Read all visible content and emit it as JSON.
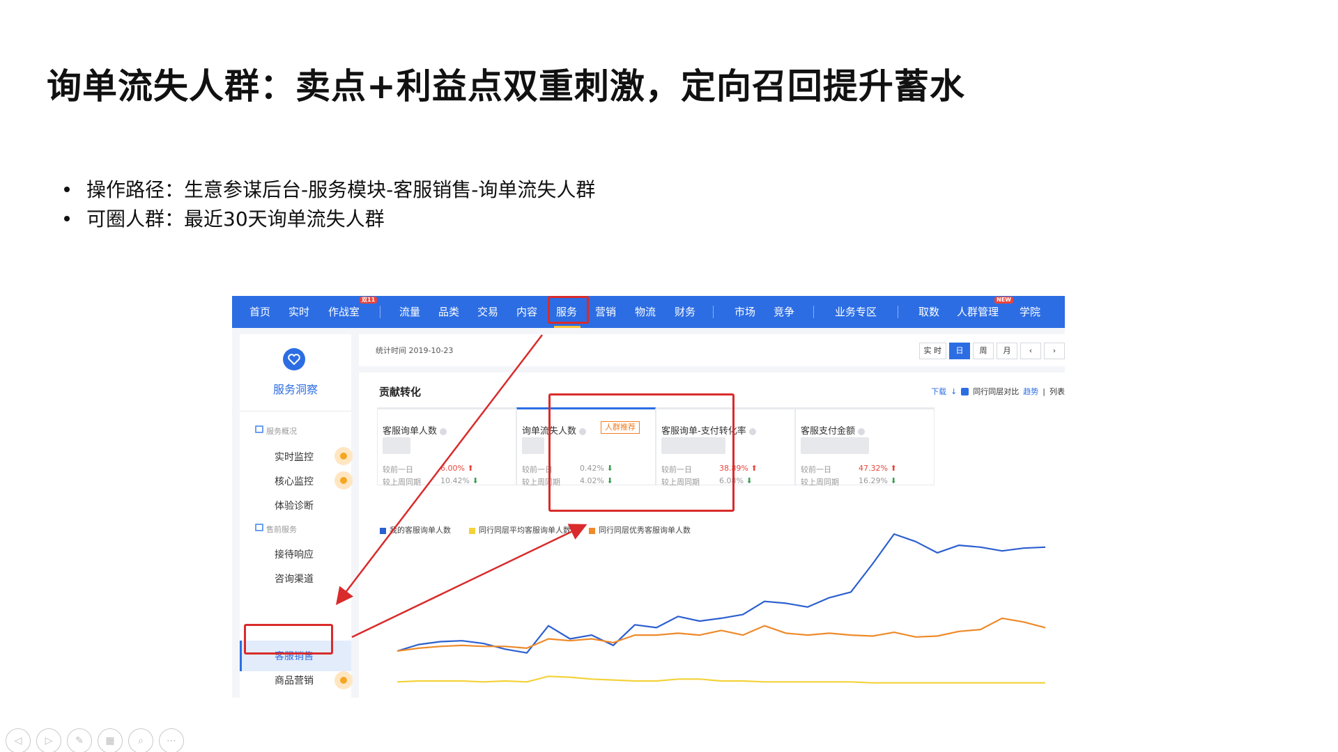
{
  "slide": {
    "title": "询单流失人群：卖点+利益点双重刺激，定向召回提升蓄水",
    "bullets": [
      "操作路径：生意参谋后台-服务模块-客服销售-询单流失人群",
      "可圈人群：最近30天询单流失人群"
    ]
  },
  "app": {
    "nav": [
      "首页",
      "实时",
      "作战室",
      "流量",
      "品类",
      "交易",
      "内容",
      "服务",
      "营销",
      "物流",
      "财务",
      "市场",
      "竞争",
      "业务专区",
      "取数",
      "人群管理",
      "学院"
    ],
    "nav_badges": {
      "zhanzhanshi": "双11",
      "renqun": "NEW"
    },
    "active_nav": "服务",
    "sidebar": {
      "title": "服务洞察",
      "sections": [
        "服务概况",
        "售前服务"
      ],
      "items": [
        "实时监控",
        "核心监控",
        "体验诊断",
        "接待响应",
        "咨询渠道",
        "客服销售",
        "商品营销"
      ],
      "active_item": "客服销售"
    },
    "stat_time": "统计时间 2019-10-23",
    "period_buttons": [
      "实 时",
      "日",
      "周",
      "月",
      "‹",
      "›"
    ],
    "active_period": "日",
    "panel": {
      "title": "贡献转化",
      "tools": {
        "download": "下载",
        "compare": "同行同层对比",
        "trend": "趋势",
        "list": "列表"
      }
    },
    "kpis": [
      {
        "name": "客服询单人数",
        "row1_label": "较前一日",
        "row1_value": "6.00%",
        "row1_dir": "up",
        "row2_label": "较上周同期",
        "row2_value": "10.42%",
        "row2_dir": "down"
      },
      {
        "name": "询单流失人数",
        "tag": "人群推荐",
        "row1_label": "较前一日",
        "row1_value": "0.42%",
        "row1_dir": "down",
        "row2_label": "较上周同期",
        "row2_value": "4.02%",
        "row2_dir": "down"
      },
      {
        "name": "客服询单-支付转化率",
        "row1_label": "较前一日",
        "row1_value": "38.89%",
        "row1_dir": "up",
        "row2_label": "较上周同期",
        "row2_value": "6.08%",
        "row2_dir": "down"
      },
      {
        "name": "客服支付金额",
        "row1_label": "较前一日",
        "row1_value": "47.32%",
        "row1_dir": "up",
        "row2_label": "较上周同期",
        "row2_value": "16.29%",
        "row2_dir": "down"
      }
    ],
    "legend": [
      {
        "label": "我的客服询单人数",
        "color": "#2c5fcf"
      },
      {
        "label": "同行同层平均客服询单人数",
        "color": "#f3d23a"
      },
      {
        "label": "同行同层优秀客服询单人数",
        "color": "#ee8a2a"
      }
    ]
  },
  "chart_data": {
    "type": "line",
    "series": [
      {
        "name": "我的客服询单人数",
        "color": "#2c5fcf",
        "values": [
          35,
          42,
          45,
          46,
          43,
          37,
          33,
          62,
          48,
          52,
          41,
          63,
          60,
          72,
          67,
          70,
          74,
          88,
          86,
          82,
          92,
          98,
          128,
          160,
          152,
          140,
          148,
          146,
          142,
          145,
          146
        ]
      },
      {
        "name": "同行同层平均客服询单人数",
        "color": "#f3d23a",
        "values": [
          2,
          3,
          3,
          3,
          2,
          3,
          2,
          8,
          7,
          5,
          4,
          3,
          3,
          5,
          5,
          3,
          3,
          2,
          2,
          2,
          2,
          2,
          1,
          1,
          1,
          1,
          1,
          1,
          1,
          1,
          1
        ]
      },
      {
        "name": "同行同层优秀客服询单人数",
        "color": "#ee8a2a",
        "values": [
          35,
          38,
          40,
          41,
          40,
          40,
          38,
          48,
          46,
          48,
          44,
          52,
          52,
          54,
          52,
          57,
          52,
          62,
          54,
          52,
          54,
          52,
          51,
          55,
          50,
          51,
          56,
          58,
          70,
          66,
          60
        ]
      }
    ]
  },
  "player_controls": [
    "prev-icon",
    "next-icon",
    "pen-icon",
    "slides-icon",
    "zoom-icon",
    "more-icon"
  ]
}
